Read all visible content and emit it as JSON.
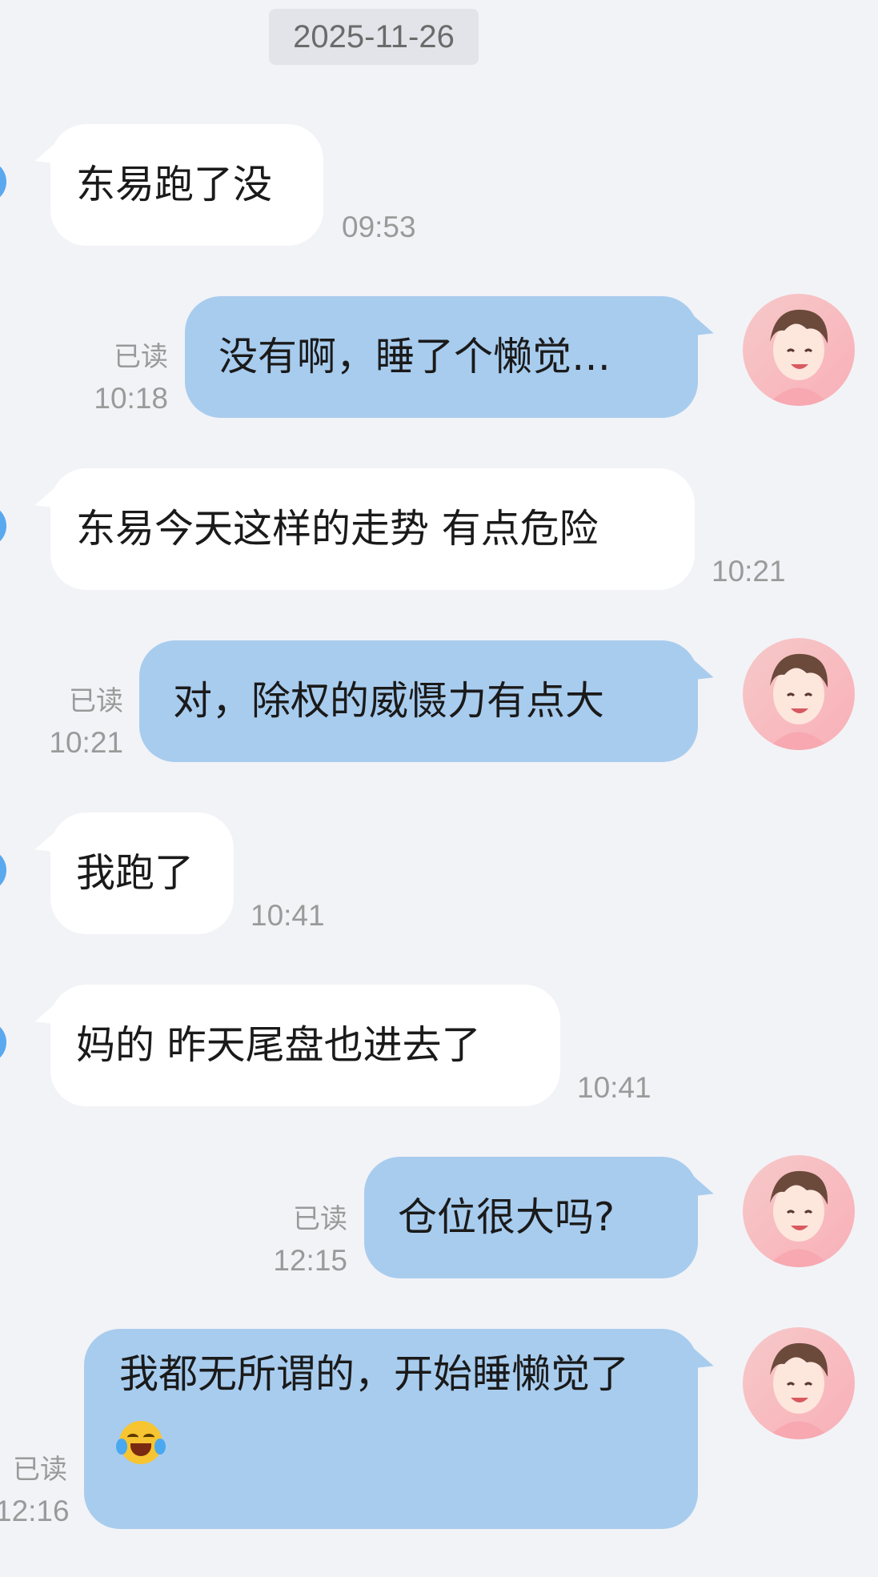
{
  "date_divider": "2025-11-26",
  "messages": [
    {
      "text": "东易跑了没",
      "time": "09:53"
    },
    {
      "text": "没有啊，睡了个懒觉…",
      "read": "已读",
      "time": "10:18"
    },
    {
      "text": "东易今天这样的走势 有点危险",
      "time": "10:21"
    },
    {
      "text": "对，除权的威慑力有点大",
      "read": "已读",
      "time": "10:21"
    },
    {
      "text": "我跑了",
      "time": "10:41"
    },
    {
      "text": "妈的 昨天尾盘也进去了",
      "time": "10:41"
    },
    {
      "text": "仓位很大吗?",
      "read": "已读",
      "time": "12:15"
    },
    {
      "text": "我都无所谓的，开始睡懒觉了",
      "emoji": "crying-laughing-emoji",
      "read": "已读",
      "time": "12:16"
    }
  ],
  "colors": {
    "background": "#f2f3f7",
    "incoming_bubble": "#ffffff",
    "outgoing_bubble": "#a8ccee",
    "contact_avatar_edge": "#5aa8ee"
  }
}
